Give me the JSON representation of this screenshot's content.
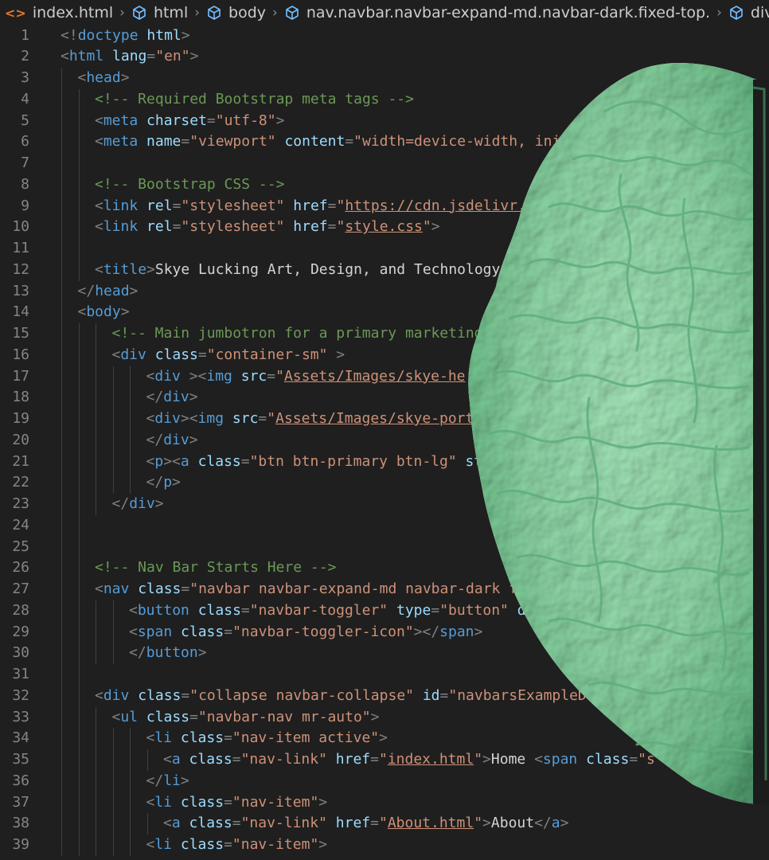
{
  "breadcrumb": [
    {
      "label": "index.html",
      "icon": "html-file-icon"
    },
    {
      "label": "html",
      "icon": "symbol-structure-icon"
    },
    {
      "label": "body",
      "icon": "symbol-structure-icon"
    },
    {
      "label": "nav.navbar.navbar-expand-md.navbar-dark.fixed-top.",
      "icon": "symbol-structure-icon"
    },
    {
      "label": "div#n",
      "icon": "symbol-structure-icon"
    }
  ],
  "colors": {
    "background": "#1f1f1f",
    "tag": "#569cd6",
    "attribute": "#9cdcfe",
    "string": "#ce9178",
    "comment": "#6a9955",
    "text": "#d4d4d4",
    "line_number": "#858585",
    "brain_overlay": "#8fd9a8"
  },
  "overlay": {
    "type": "image",
    "subject": "green brain sculpture",
    "icon": "brain-image"
  },
  "lines": [
    {
      "n": "1",
      "indent": 0,
      "tokens": [
        [
          "p",
          "<!"
        ],
        [
          "tag",
          "doctype"
        ],
        [
          "p",
          " "
        ],
        [
          "attr",
          "html"
        ],
        [
          "p",
          ">"
        ]
      ]
    },
    {
      "n": "2",
      "indent": 0,
      "tokens": [
        [
          "p",
          "<"
        ],
        [
          "tag",
          "html"
        ],
        [
          "p",
          " "
        ],
        [
          "attr",
          "lang"
        ],
        [
          "p",
          "="
        ],
        [
          "str",
          "\"en\""
        ],
        [
          "p",
          ">"
        ]
      ]
    },
    {
      "n": "3",
      "indent": 1,
      "tokens": [
        [
          "p",
          "<"
        ],
        [
          "tag",
          "head"
        ],
        [
          "p",
          ">"
        ]
      ]
    },
    {
      "n": "4",
      "indent": 2,
      "tokens": [
        [
          "c",
          "<!-- Required Bootstrap meta tags -->"
        ]
      ]
    },
    {
      "n": "5",
      "indent": 2,
      "tokens": [
        [
          "p",
          "<"
        ],
        [
          "tag",
          "meta"
        ],
        [
          "p",
          " "
        ],
        [
          "attr",
          "charset"
        ],
        [
          "p",
          "="
        ],
        [
          "str",
          "\"utf-8\""
        ],
        [
          "p",
          ">"
        ]
      ]
    },
    {
      "n": "6",
      "indent": 2,
      "tokens": [
        [
          "p",
          "<"
        ],
        [
          "tag",
          "meta"
        ],
        [
          "p",
          " "
        ],
        [
          "attr",
          "name"
        ],
        [
          "p",
          "="
        ],
        [
          "str",
          "\"viewport\""
        ],
        [
          "p",
          " "
        ],
        [
          "attr",
          "content"
        ],
        [
          "p",
          "="
        ],
        [
          "str",
          "\"width=device-width, initi"
        ]
      ]
    },
    {
      "n": "7",
      "indent": 2,
      "tokens": []
    },
    {
      "n": "8",
      "indent": 2,
      "tokens": [
        [
          "c",
          "<!-- Bootstrap CSS -->"
        ]
      ]
    },
    {
      "n": "9",
      "indent": 2,
      "tokens": [
        [
          "p",
          "<"
        ],
        [
          "tag",
          "link"
        ],
        [
          "p",
          " "
        ],
        [
          "attr",
          "rel"
        ],
        [
          "p",
          "="
        ],
        [
          "str",
          "\"stylesheet\""
        ],
        [
          "p",
          " "
        ],
        [
          "attr",
          "href"
        ],
        [
          "p",
          "="
        ],
        [
          "str",
          "\""
        ],
        [
          "link",
          "https://cdn.jsdelivr."
        ]
      ]
    },
    {
      "n": "10",
      "indent": 2,
      "tokens": [
        [
          "p",
          "<"
        ],
        [
          "tag",
          "link"
        ],
        [
          "p",
          " "
        ],
        [
          "attr",
          "rel"
        ],
        [
          "p",
          "="
        ],
        [
          "str",
          "\"stylesheet\""
        ],
        [
          "p",
          " "
        ],
        [
          "attr",
          "href"
        ],
        [
          "p",
          "="
        ],
        [
          "str",
          "\""
        ],
        [
          "link",
          "style.css"
        ],
        [
          "str",
          "\""
        ],
        [
          "p",
          ">"
        ]
      ]
    },
    {
      "n": "11",
      "indent": 2,
      "tokens": []
    },
    {
      "n": "12",
      "indent": 2,
      "tokens": [
        [
          "p",
          "<"
        ],
        [
          "tag",
          "title"
        ],
        [
          "p",
          ">"
        ],
        [
          "t",
          "Skye Lucking Art, Design, and Technology"
        ]
      ]
    },
    {
      "n": "13",
      "indent": 1,
      "tokens": [
        [
          "p",
          "</"
        ],
        [
          "tag",
          "head"
        ],
        [
          "p",
          ">"
        ]
      ]
    },
    {
      "n": "14",
      "indent": 1,
      "tokens": [
        [
          "p",
          "<"
        ],
        [
          "tag",
          "body"
        ],
        [
          "p",
          ">"
        ]
      ]
    },
    {
      "n": "15",
      "indent": 3,
      "tokens": [
        [
          "c",
          "<!-- Main jumbotron for a primary marketing"
        ]
      ]
    },
    {
      "n": "16",
      "indent": 3,
      "tokens": [
        [
          "p",
          "<"
        ],
        [
          "tag",
          "div"
        ],
        [
          "p",
          " "
        ],
        [
          "attr",
          "class"
        ],
        [
          "p",
          "="
        ],
        [
          "str",
          "\"container-sm\""
        ],
        [
          "p",
          " >"
        ]
      ]
    },
    {
      "n": "17",
      "indent": 5,
      "tokens": [
        [
          "p",
          "<"
        ],
        [
          "tag",
          "div"
        ],
        [
          "p",
          " ><"
        ],
        [
          "tag",
          "img"
        ],
        [
          "p",
          " "
        ],
        [
          "attr",
          "src"
        ],
        [
          "p",
          "="
        ],
        [
          "str",
          "\""
        ],
        [
          "link",
          "Assets/Images/skye-he"
        ]
      ]
    },
    {
      "n": "18",
      "indent": 5,
      "tokens": [
        [
          "p",
          "</"
        ],
        [
          "tag",
          "div"
        ],
        [
          "p",
          ">"
        ]
      ]
    },
    {
      "n": "19",
      "indent": 5,
      "tokens": [
        [
          "p",
          "<"
        ],
        [
          "tag",
          "div"
        ],
        [
          "p",
          "><"
        ],
        [
          "tag",
          "img"
        ],
        [
          "p",
          " "
        ],
        [
          "attr",
          "src"
        ],
        [
          "p",
          "="
        ],
        [
          "str",
          "\""
        ],
        [
          "link",
          "Assets/Images/skye-port"
        ]
      ]
    },
    {
      "n": "20",
      "indent": 5,
      "tokens": [
        [
          "p",
          "</"
        ],
        [
          "tag",
          "div"
        ],
        [
          "p",
          ">"
        ]
      ]
    },
    {
      "n": "21",
      "indent": 5,
      "tokens": [
        [
          "p",
          "<"
        ],
        [
          "tag",
          "p"
        ],
        [
          "p",
          "><"
        ],
        [
          "tag",
          "a"
        ],
        [
          "p",
          " "
        ],
        [
          "attr",
          "class"
        ],
        [
          "p",
          "="
        ],
        [
          "str",
          "\"btn btn-primary btn-lg\""
        ],
        [
          "p",
          " "
        ],
        [
          "attr",
          "st"
        ]
      ]
    },
    {
      "n": "22",
      "indent": 5,
      "tokens": [
        [
          "p",
          "</"
        ],
        [
          "tag",
          "p"
        ],
        [
          "p",
          ">"
        ]
      ]
    },
    {
      "n": "23",
      "indent": 3,
      "tokens": [
        [
          "p",
          "</"
        ],
        [
          "tag",
          "div"
        ],
        [
          "p",
          ">"
        ]
      ]
    },
    {
      "n": "24",
      "indent": 2,
      "tokens": []
    },
    {
      "n": "25",
      "indent": 2,
      "tokens": []
    },
    {
      "n": "26",
      "indent": 2,
      "tokens": [
        [
          "c",
          "<!-- Nav Bar Starts Here -->"
        ]
      ]
    },
    {
      "n": "27",
      "indent": 2,
      "tokens": [
        [
          "p",
          "<"
        ],
        [
          "tag",
          "nav"
        ],
        [
          "p",
          " "
        ],
        [
          "attr",
          "class"
        ],
        [
          "p",
          "="
        ],
        [
          "str",
          "\"navbar navbar-expand-md navbar-dark fix"
        ]
      ]
    },
    {
      "n": "28",
      "indent": 4,
      "tokens": [
        [
          "p",
          "<"
        ],
        [
          "tag",
          "button"
        ],
        [
          "p",
          " "
        ],
        [
          "attr",
          "class"
        ],
        [
          "p",
          "="
        ],
        [
          "str",
          "\"navbar-toggler\""
        ],
        [
          "p",
          " "
        ],
        [
          "attr",
          "type"
        ],
        [
          "p",
          "="
        ],
        [
          "str",
          "\"button\""
        ],
        [
          "p",
          " "
        ],
        [
          "attr",
          "data"
        ]
      ]
    },
    {
      "n": "29",
      "indent": 4,
      "tokens": [
        [
          "p",
          "<"
        ],
        [
          "tag",
          "span"
        ],
        [
          "p",
          " "
        ],
        [
          "attr",
          "class"
        ],
        [
          "p",
          "="
        ],
        [
          "str",
          "\"navbar-toggler-icon\""
        ],
        [
          "p",
          "></"
        ],
        [
          "tag",
          "span"
        ],
        [
          "p",
          ">"
        ]
      ]
    },
    {
      "n": "30",
      "indent": 4,
      "tokens": [
        [
          "p",
          "</"
        ],
        [
          "tag",
          "button"
        ],
        [
          "p",
          ">"
        ]
      ]
    },
    {
      "n": "31",
      "indent": 2,
      "tokens": []
    },
    {
      "n": "32",
      "indent": 2,
      "tokens": [
        [
          "p",
          "<"
        ],
        [
          "tag",
          "div"
        ],
        [
          "p",
          " "
        ],
        [
          "attr",
          "class"
        ],
        [
          "p",
          "="
        ],
        [
          "str",
          "\"collapse navbar-collapse\""
        ],
        [
          "p",
          " "
        ],
        [
          "attr",
          "id"
        ],
        [
          "p",
          "="
        ],
        [
          "str",
          "\"navbarsExampleD"
        ]
      ]
    },
    {
      "n": "33",
      "indent": 3,
      "tokens": [
        [
          "p",
          "<"
        ],
        [
          "tag",
          "ul"
        ],
        [
          "p",
          " "
        ],
        [
          "attr",
          "class"
        ],
        [
          "p",
          "="
        ],
        [
          "str",
          "\"navbar-nav mr-auto\""
        ],
        [
          "p",
          ">"
        ]
      ]
    },
    {
      "n": "34",
      "indent": 5,
      "tokens": [
        [
          "p",
          "<"
        ],
        [
          "tag",
          "li"
        ],
        [
          "p",
          " "
        ],
        [
          "attr",
          "class"
        ],
        [
          "p",
          "="
        ],
        [
          "str",
          "\"nav-item active\""
        ],
        [
          "p",
          ">"
        ]
      ]
    },
    {
      "n": "35",
      "indent": 6,
      "tokens": [
        [
          "p",
          "<"
        ],
        [
          "tag",
          "a"
        ],
        [
          "p",
          " "
        ],
        [
          "attr",
          "class"
        ],
        [
          "p",
          "="
        ],
        [
          "str",
          "\"nav-link\""
        ],
        [
          "p",
          " "
        ],
        [
          "attr",
          "href"
        ],
        [
          "p",
          "="
        ],
        [
          "str",
          "\""
        ],
        [
          "link",
          "index.html"
        ],
        [
          "str",
          "\""
        ],
        [
          "p",
          ">"
        ],
        [
          "t",
          "Home "
        ],
        [
          "p",
          "<"
        ],
        [
          "tag",
          "span"
        ],
        [
          "p",
          " "
        ],
        [
          "attr",
          "class"
        ],
        [
          "p",
          "="
        ],
        [
          "str",
          "\"s"
        ]
      ]
    },
    {
      "n": "36",
      "indent": 5,
      "tokens": [
        [
          "p",
          "</"
        ],
        [
          "tag",
          "li"
        ],
        [
          "p",
          ">"
        ]
      ]
    },
    {
      "n": "37",
      "indent": 5,
      "tokens": [
        [
          "p",
          "<"
        ],
        [
          "tag",
          "li"
        ],
        [
          "p",
          " "
        ],
        [
          "attr",
          "class"
        ],
        [
          "p",
          "="
        ],
        [
          "str",
          "\"nav-item\""
        ],
        [
          "p",
          ">"
        ]
      ]
    },
    {
      "n": "38",
      "indent": 6,
      "tokens": [
        [
          "p",
          "<"
        ],
        [
          "tag",
          "a"
        ],
        [
          "p",
          " "
        ],
        [
          "attr",
          "class"
        ],
        [
          "p",
          "="
        ],
        [
          "str",
          "\"nav-link\""
        ],
        [
          "p",
          " "
        ],
        [
          "attr",
          "href"
        ],
        [
          "p",
          "="
        ],
        [
          "str",
          "\""
        ],
        [
          "link",
          "About.html"
        ],
        [
          "str",
          "\""
        ],
        [
          "p",
          ">"
        ],
        [
          "t",
          "About"
        ],
        [
          "p",
          "</"
        ],
        [
          "tag",
          "a"
        ],
        [
          "p",
          ">"
        ]
      ]
    },
    {
      "n": "39",
      "indent": 5,
      "tokens": [
        [
          "p",
          "<"
        ],
        [
          "tag",
          "li"
        ],
        [
          "p",
          " "
        ],
        [
          "attr",
          "class"
        ],
        [
          "p",
          "="
        ],
        [
          "str",
          "\"nav-item\""
        ],
        [
          "p",
          ">"
        ]
      ]
    }
  ]
}
